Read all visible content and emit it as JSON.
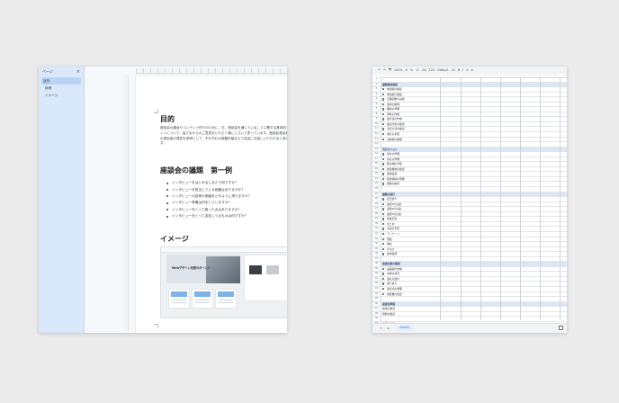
{
  "doc": {
    "outline": {
      "title": "ページ",
      "close": "×",
      "items": [
        "目的",
        "詳細",
        "イメージ"
      ]
    },
    "purpose_heading": "目的",
    "purpose_text": "座談会の趣旨やコンテンツ作りのために、日、座談会を通していることに関する具体的なポイントについて、皆さまからのご意見をいただく場にしたいと思っています。座談会参加者は他の参加者の発言を参考にして、それぞれの経験を踏まえて自由にお話しいただけると幸いです。",
    "topics_heading": "座談会の議題　第一例",
    "bullets": [
      "インタビューをはじめるにあたり何ですか？",
      "インタビューを担当している経験はありますか？",
      "インタビューの技術の価値をどのように測りますか？",
      "インタビュー準備は何をしていますか？",
      "インタビューをとって困った点はありますか？",
      "インタビューをとって返答しうるものは何ですか？"
    ],
    "image_heading": "イメージ",
    "preview_title": "Webデザイン改善のポイント"
  },
  "sheet": {
    "toolbar": [
      "↶",
      "↷",
      "🖶",
      "100%",
      "¥",
      "%",
      ".0",
      ".00",
      "123",
      "Default",
      "10",
      "B",
      "I",
      "S",
      "A"
    ],
    "rows": [
      {
        "n": "1",
        "t": "",
        "s": false,
        "cb": false
      },
      {
        "n": "2",
        "t": "議題事前確認",
        "s": true,
        "cb": false
      },
      {
        "n": "3",
        "t": "参加者の確認",
        "s": false,
        "cb": true
      },
      {
        "n": "4",
        "t": "参加者の連絡",
        "s": false,
        "cb": true
      },
      {
        "n": "5",
        "t": "日程調整の実施",
        "s": false,
        "cb": true
      },
      {
        "n": "6",
        "t": "会場の確保",
        "s": false,
        "cb": true
      },
      {
        "n": "7",
        "t": "機材の準備",
        "s": false,
        "cb": true
      },
      {
        "n": "8",
        "t": "資料の作成",
        "s": false,
        "cb": true
      },
      {
        "n": "9",
        "t": "進行表の作成",
        "s": false,
        "cb": true
      },
      {
        "n": "10",
        "t": "役割分担の確認",
        "s": false,
        "cb": true
      },
      {
        "n": "11",
        "t": "当日の流れ確認",
        "s": false,
        "cb": true
      },
      {
        "n": "12",
        "t": "謝礼の手配",
        "s": false,
        "cb": true
      },
      {
        "n": "13",
        "t": "記録係の確保",
        "s": false,
        "cb": true
      },
      {
        "n": "14",
        "t": "",
        "s": false,
        "cb": false
      },
      {
        "n": "15",
        "t": "当日のリスト",
        "s": true,
        "cb": false
      },
      {
        "n": "16",
        "t": "受付の準備",
        "s": false,
        "cb": true
      },
      {
        "n": "17",
        "t": "名札の準備",
        "s": false,
        "cb": true
      },
      {
        "n": "18",
        "t": "飲み物の手配",
        "s": false,
        "cb": true
      },
      {
        "n": "19",
        "t": "録音機材の確認",
        "s": false,
        "cb": true
      },
      {
        "n": "20",
        "t": "会場設営",
        "s": false,
        "cb": true
      },
      {
        "n": "21",
        "t": "配布資料の準備",
        "s": false,
        "cb": true
      },
      {
        "n": "22",
        "t": "開始の挨拶",
        "s": false,
        "cb": true
      },
      {
        "n": "23",
        "t": "",
        "s": false,
        "cb": false
      },
      {
        "n": "24",
        "t": "議題の進行",
        "s": true,
        "cb": false
      },
      {
        "n": "25",
        "t": "自己紹介",
        "s": false,
        "cb": true
      },
      {
        "n": "26",
        "t": "議題1の討議",
        "s": false,
        "cb": true
      },
      {
        "n": "27",
        "t": "議題2の討議",
        "s": false,
        "cb": true
      },
      {
        "n": "28",
        "t": "議題3の討議",
        "s": false,
        "cb": true
      },
      {
        "n": "29",
        "t": "質疑応答",
        "s": false,
        "cb": true
      },
      {
        "n": "30",
        "t": "まとめ",
        "s": false,
        "cb": true
      },
      {
        "n": "31",
        "t": "次回の予定",
        "s": false,
        "cb": true
      },
      {
        "n": "32",
        "t": "アンケート",
        "s": false,
        "cb": true
      },
      {
        "n": "33",
        "t": "閉会",
        "s": false,
        "cb": true
      },
      {
        "n": "34",
        "t": "撤収",
        "s": false,
        "cb": true
      },
      {
        "n": "35",
        "t": "片付け",
        "s": false,
        "cb": true
      },
      {
        "n": "36",
        "t": "会場返却",
        "s": false,
        "cb": true
      },
      {
        "n": "37",
        "t": "",
        "s": false,
        "cb": false
      },
      {
        "n": "38",
        "t": "座談会後の確認",
        "s": true,
        "cb": false
      },
      {
        "n": "39",
        "t": "議事録の作成",
        "s": false,
        "cb": true
      },
      {
        "n": "40",
        "t": "内容の共有",
        "s": false,
        "cb": true
      },
      {
        "n": "41",
        "t": "謝礼の送付",
        "s": false,
        "cb": true
      },
      {
        "n": "42",
        "t": "振り返り",
        "s": false,
        "cb": true
      },
      {
        "n": "43",
        "t": "改善点の整理",
        "s": false,
        "cb": true
      },
      {
        "n": "44",
        "t": "報告書の提出",
        "s": false,
        "cb": true
      },
      {
        "n": "45",
        "t": "",
        "s": false,
        "cb": false
      },
      {
        "n": "46",
        "t": "座談会準備",
        "s": true,
        "cb": false
      },
      {
        "n": "47",
        "t": "会場の確認",
        "s": false,
        "cb": false
      },
      {
        "n": "48",
        "t": "資料の確認",
        "s": false,
        "cb": false
      },
      {
        "n": "49",
        "t": "",
        "s": false,
        "cb": false
      },
      {
        "n": "50",
        "t": "日程の確認",
        "s": false,
        "cb": false
      },
      {
        "n": "51",
        "t": "参加者の確認",
        "s": false,
        "cb": false
      },
      {
        "n": "52",
        "t": "",
        "s": false,
        "cb": false
      }
    ],
    "tabs": {
      "add": "+",
      "menu": "≡",
      "active": "Sheet1"
    }
  }
}
